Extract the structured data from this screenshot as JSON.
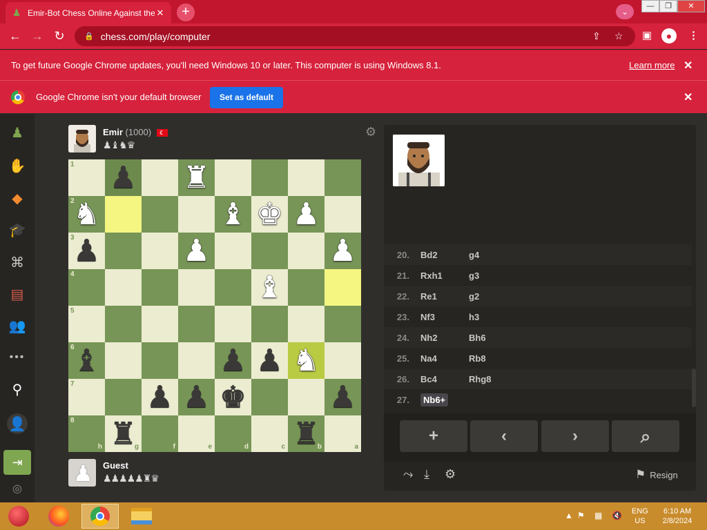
{
  "browser": {
    "tab_title": "Emir-Bot Chess Online Against the",
    "tab_close": "✕",
    "new_tab": "+",
    "url": "chess.com/play/computer",
    "win_min": "—",
    "win_max": "❐",
    "win_close": "✕"
  },
  "infobar1": {
    "text": "To get future Google Chrome updates, you'll need Windows 10 or later. This computer is using Windows 8.1.",
    "learn_more": "Learn more",
    "close": "✕"
  },
  "infobar2": {
    "text": "Google Chrome isn't your default browser",
    "button": "Set as default",
    "close": "✕"
  },
  "opponent": {
    "name": "Emir",
    "rating": "(1000)",
    "flag": "🇹🇷",
    "captured": "♟♝♞♛"
  },
  "player": {
    "name": "Guest",
    "captured": "♟♟♟♟♟♜♛"
  },
  "board": {
    "ranks": [
      "1",
      "2",
      "3",
      "4",
      "5",
      "6",
      "7",
      "8"
    ],
    "files": [
      "h",
      "g",
      "f",
      "e",
      "d",
      "c",
      "b",
      "a"
    ],
    "rows": [
      [
        "",
        "b:♟",
        "",
        "w:♜",
        "",
        "",
        "",
        ""
      ],
      [
        "w:♞",
        "",
        "",
        "",
        "w:♝",
        "w:♚",
        "w:♟",
        ""
      ],
      [
        "b:♟",
        "",
        "",
        "w:♟",
        "",
        "",
        "",
        "w:♟"
      ],
      [
        "",
        "",
        "",
        "",
        "",
        "w:♝",
        "",
        ""
      ],
      [
        "",
        "",
        "",
        "",
        "",
        "",
        "",
        ""
      ],
      [
        "b:♝",
        "",
        "",
        "",
        "b:♟",
        "b:♟",
        "w:♞",
        ""
      ],
      [
        "",
        "",
        "b:♟",
        "b:♟",
        "b:♚",
        "",
        "",
        "b:♟"
      ],
      [
        "",
        "b:♜",
        "",
        "",
        "",
        "",
        "b:♜",
        ""
      ]
    ],
    "highlights": [
      "1,1",
      "3,7",
      "5,6"
    ]
  },
  "moves": [
    {
      "n": "20.",
      "w": "Bd2",
      "b": "g4"
    },
    {
      "n": "21.",
      "w": "Rxh1",
      "b": "g3"
    },
    {
      "n": "22.",
      "w": "Re1",
      "b": "g2"
    },
    {
      "n": "23.",
      "w": "Nf3",
      "b": "h3"
    },
    {
      "n": "24.",
      "w": "Nh2",
      "b": "Bh6"
    },
    {
      "n": "25.",
      "w": "Na4",
      "b": "Rb8"
    },
    {
      "n": "26.",
      "w": "Bc4",
      "b": "Rhg8"
    },
    {
      "n": "27.",
      "w": "Nb6+",
      "b": ""
    }
  ],
  "controls": {
    "add": "+",
    "prev": "‹",
    "next": "›",
    "analyze": "⌕",
    "resign": "Resign"
  },
  "taskbar": {
    "lang1": "ENG",
    "lang2": "US",
    "time": "6:10 AM",
    "date": "2/8/2024"
  }
}
